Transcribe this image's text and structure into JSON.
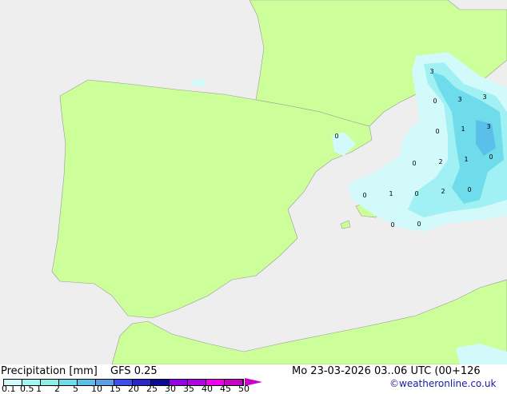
{
  "title": "Precipitation [mm]",
  "model": "GFS 0.25",
  "datetime": "Mo 23-03-2026 03..06 UTC (00+126",
  "credit": "©weatheronline.co.uk",
  "legend": {
    "ticks": [
      "0.1",
      "0.5",
      "1",
      "2",
      "5",
      "10",
      "15",
      "20",
      "25",
      "30",
      "35",
      "40",
      "45",
      "50"
    ],
    "colors": [
      "#d2fafa",
      "#a0f5f5",
      "#8ceee6",
      "#6edcea",
      "#5ac0ea",
      "#5aa0e6",
      "#3c50f0",
      "#2828c8",
      "#0a0a9b",
      "#9600e6",
      "#b400e6",
      "#f000f0",
      "#c800c8"
    ]
  },
  "colors": {
    "sea": "#eeeeee",
    "land": "#ccff99",
    "rain_light": "#d2fafa",
    "rain_mid": "#a0f0f4",
    "rain_heavy": "#6edcea",
    "rain_max": "#5ac0ea"
  },
  "values": [
    "3",
    "3",
    "3",
    "0",
    "0",
    "1",
    "3",
    "0",
    "0",
    "2",
    "1",
    "0",
    "0",
    "1",
    "2",
    "0",
    "0",
    "0",
    "0"
  ]
}
